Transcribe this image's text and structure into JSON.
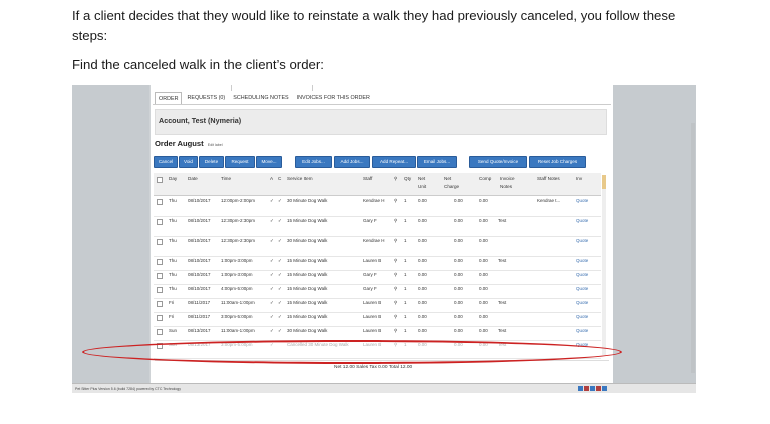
{
  "doc": {
    "p1": "If a client decides that they would like to reinstate a walk they had previously canceled, you follow these steps:",
    "p2": "Find the canceled walk in the client’s order:"
  },
  "app": {
    "tabs": [
      "ORDER",
      "REQUESTS (0)",
      "SCHEDULING NOTES",
      "INVOICES FOR THIS ORDER"
    ],
    "account": "Account, Test (Nymeria)",
    "order_title": "Order August",
    "order_edit": "Edit label",
    "buttons": [
      "Cancel",
      "Void",
      "Delete",
      "Request",
      "Move...",
      "Edit Jobs...",
      "Add Jobs...",
      "Add Repeat...",
      "Email Jobs...",
      "Send Quote/Invoice",
      "Reset Job Charges"
    ],
    "headers": [
      "Day",
      "Date",
      "Time",
      "A",
      "C",
      "Service Item",
      "Staff",
      "Qty",
      "Net Unit",
      "Net Charge",
      "Comp",
      "Invoice Notes",
      "Staff Notes",
      "Inv"
    ],
    "rows": [
      {
        "day": "Thu",
        "date": "08/10/2017",
        "time": "12:00pm-2:00pm",
        "a": "✓",
        "c": "✓",
        "service": "30 Minute Dog Walk",
        "staff": "Kendrae H",
        "qty": "1",
        "unit": "0.00",
        "charge": "0.00",
        "comp": "0.00",
        "notes": "",
        "staffnotes": "Kendrae t...",
        "inv": "Quote"
      },
      {
        "day": "Thu",
        "date": "08/10/2017",
        "time": "12:30pm-2:30pm",
        "a": "✓",
        "c": "✓",
        "service": "15 Minute Dog Walk",
        "staff": "Gary F",
        "qty": "1",
        "unit": "0.00",
        "charge": "0.00",
        "comp": "0.00",
        "notes": "Test",
        "staffnotes": "",
        "inv": "Quote"
      },
      {
        "day": "Thu",
        "date": "08/10/2017",
        "time": "12:30pm-2:30pm",
        "a": "✓",
        "c": "✓",
        "service": "30 Minute Dog Walk",
        "staff": "Kendrae H",
        "qty": "1",
        "unit": "0.00",
        "charge": "0.00",
        "comp": "0.00",
        "notes": "",
        "staffnotes": "",
        "inv": "Quote"
      },
      {
        "day": "Thu",
        "date": "08/10/2017",
        "time": "1:00pm-3:00pm",
        "a": "✓",
        "c": "✓",
        "service": "15 Minute Dog Walk",
        "staff": "Lauren B",
        "qty": "1",
        "unit": "0.00",
        "charge": "0.00",
        "comp": "0.00",
        "notes": "Test",
        "staffnotes": "",
        "inv": "Quote"
      },
      {
        "day": "Thu",
        "date": "08/10/2017",
        "time": "1:00pm-3:00pm",
        "a": "✓",
        "c": "✓",
        "service": "15 Minute Dog Walk",
        "staff": "Gary F",
        "qty": "1",
        "unit": "0.00",
        "charge": "0.00",
        "comp": "0.00",
        "notes": "",
        "staffnotes": "",
        "inv": "Quote"
      },
      {
        "day": "Thu",
        "date": "08/10/2017",
        "time": "4:00pm-5:00pm",
        "a": "✓",
        "c": "✓",
        "service": "15 Minute Dog Walk",
        "staff": "Gary F",
        "qty": "1",
        "unit": "0.00",
        "charge": "0.00",
        "comp": "0.00",
        "notes": "",
        "staffnotes": "",
        "inv": "Quote"
      },
      {
        "day": "Fri",
        "date": "08/11/2017",
        "time": "11:00am-1:00pm",
        "a": "✓",
        "c": "✓",
        "service": "15 Minute Dog Walk",
        "staff": "Lauren B",
        "qty": "1",
        "unit": "0.00",
        "charge": "0.00",
        "comp": "0.00",
        "notes": "Test",
        "staffnotes": "",
        "inv": "Quote"
      },
      {
        "day": "Fri",
        "date": "08/11/2017",
        "time": "3:00pm-5:00pm",
        "a": "✓",
        "c": "✓",
        "service": "15 Minute Dog Walk",
        "staff": "Lauren B",
        "qty": "1",
        "unit": "0.00",
        "charge": "0.00",
        "comp": "0.00",
        "notes": "",
        "staffnotes": "",
        "inv": "Quote"
      },
      {
        "day": "Sun",
        "date": "08/13/2017",
        "time": "11:00am-1:00pm",
        "a": "✓",
        "c": "✓",
        "service": "30 Minute Dog Walk",
        "staff": "Lauren B",
        "qty": "1",
        "unit": "0.00",
        "charge": "0.00",
        "comp": "0.00",
        "notes": "Test",
        "staffnotes": "",
        "inv": "Quote"
      },
      {
        "day": "Sun",
        "date": "08/13/2017",
        "time": "3:00pm-5:00pm",
        "a": "✓",
        "c": "",
        "service": "Cancelled 30 Minute Dog Walk",
        "staff": "Lauren B",
        "qty": "1",
        "unit": "0.00",
        "charge": "0.00",
        "comp": "0.00",
        "notes": "Test",
        "staffnotes": "",
        "inv": "Quote"
      }
    ],
    "totals": "Net 12.00  Sales Tax 0.00  Total 12.00",
    "version": "Pet Sitter Plus Version 5.6 (build 7284) powered by CTC Technology",
    "accent": "#3a78c0",
    "highlight": "#cc2222"
  }
}
